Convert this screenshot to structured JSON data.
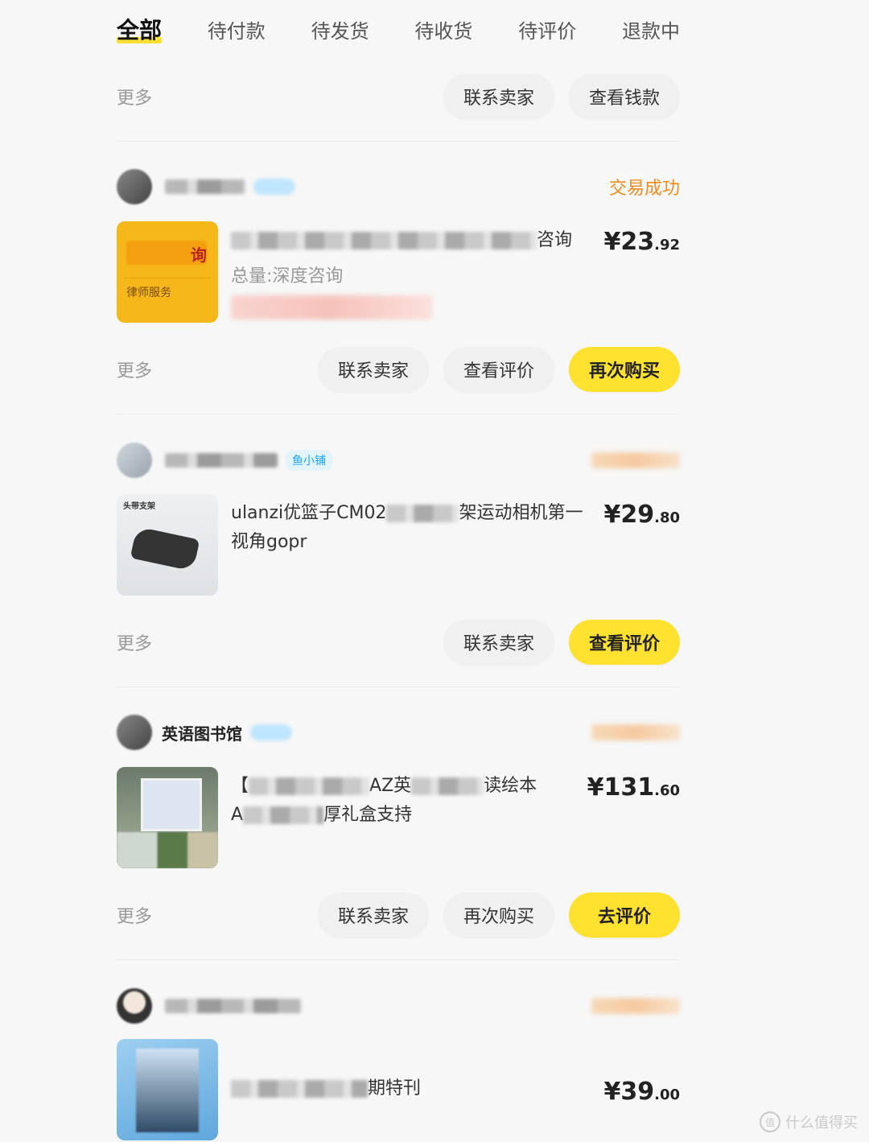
{
  "tabs": [
    "全部",
    "待付款",
    "待发货",
    "待收货",
    "待评价",
    "退款中"
  ],
  "more_label": "更多",
  "top_actions": [
    "联系卖家",
    "查看钱款"
  ],
  "orders": [
    {
      "status": "交易成功",
      "product_title_tail": "咨询",
      "product_sub": "总量:深度咨询",
      "thumb_text_q": "询",
      "thumb_text_service": "律师服务",
      "price_int": "¥23",
      "price_dec": ".92",
      "actions": [
        "联系卖家",
        "查看评价",
        "再次购买"
      ]
    },
    {
      "badge": "鱼小铺",
      "thumb_label": "头带支架",
      "product_title_head": "ulanzi优篮子CM02",
      "product_title_tail": "架运动相机第一视角gopr",
      "price_int": "¥29",
      "price_dec": ".80",
      "actions": [
        "联系卖家",
        "查看评价"
      ]
    },
    {
      "shop_name": "英语图书馆",
      "product_title_head": "【",
      "product_title_mid": "AZ英",
      "product_title_tail": "读绘本",
      "product_title_line2_head": "A",
      "product_title_line2_tail": "厚礼盒支持",
      "price_int": "¥131",
      "price_dec": ".60",
      "actions": [
        "联系卖家",
        "再次购买",
        "去评价"
      ]
    },
    {
      "product_title_tail": "期特刊",
      "price_int": "¥39",
      "price_dec": ".00"
    }
  ],
  "watermark": "什么值得买"
}
